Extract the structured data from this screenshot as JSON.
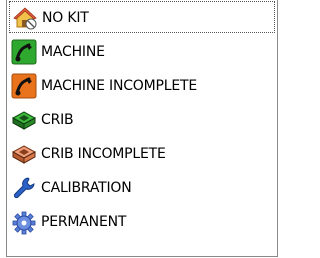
{
  "dropdown": {
    "items": [
      {
        "label": "NO KIT",
        "icon": "home-house-icon",
        "selected": true
      },
      {
        "label": "MACHINE",
        "icon": "machine-green-icon",
        "selected": false
      },
      {
        "label": "MACHINE INCOMPLETE",
        "icon": "machine-orange-icon",
        "selected": false
      },
      {
        "label": "CRIB",
        "icon": "crib-green-icon",
        "selected": false
      },
      {
        "label": "CRIB INCOMPLETE",
        "icon": "crib-orange-icon",
        "selected": false
      },
      {
        "label": "CALIBRATION",
        "icon": "wrench-icon",
        "selected": false
      },
      {
        "label": "PERMANENT",
        "icon": "gear-icon",
        "selected": false
      }
    ]
  },
  "colors": {
    "machine_green": "#2fa82f",
    "machine_orange": "#e8731c",
    "crib_green": "#2f8f2f",
    "crib_orange": "#d9784a",
    "wrench_blue": "#2b62c7",
    "gear_blue": "#5a7fd6"
  }
}
